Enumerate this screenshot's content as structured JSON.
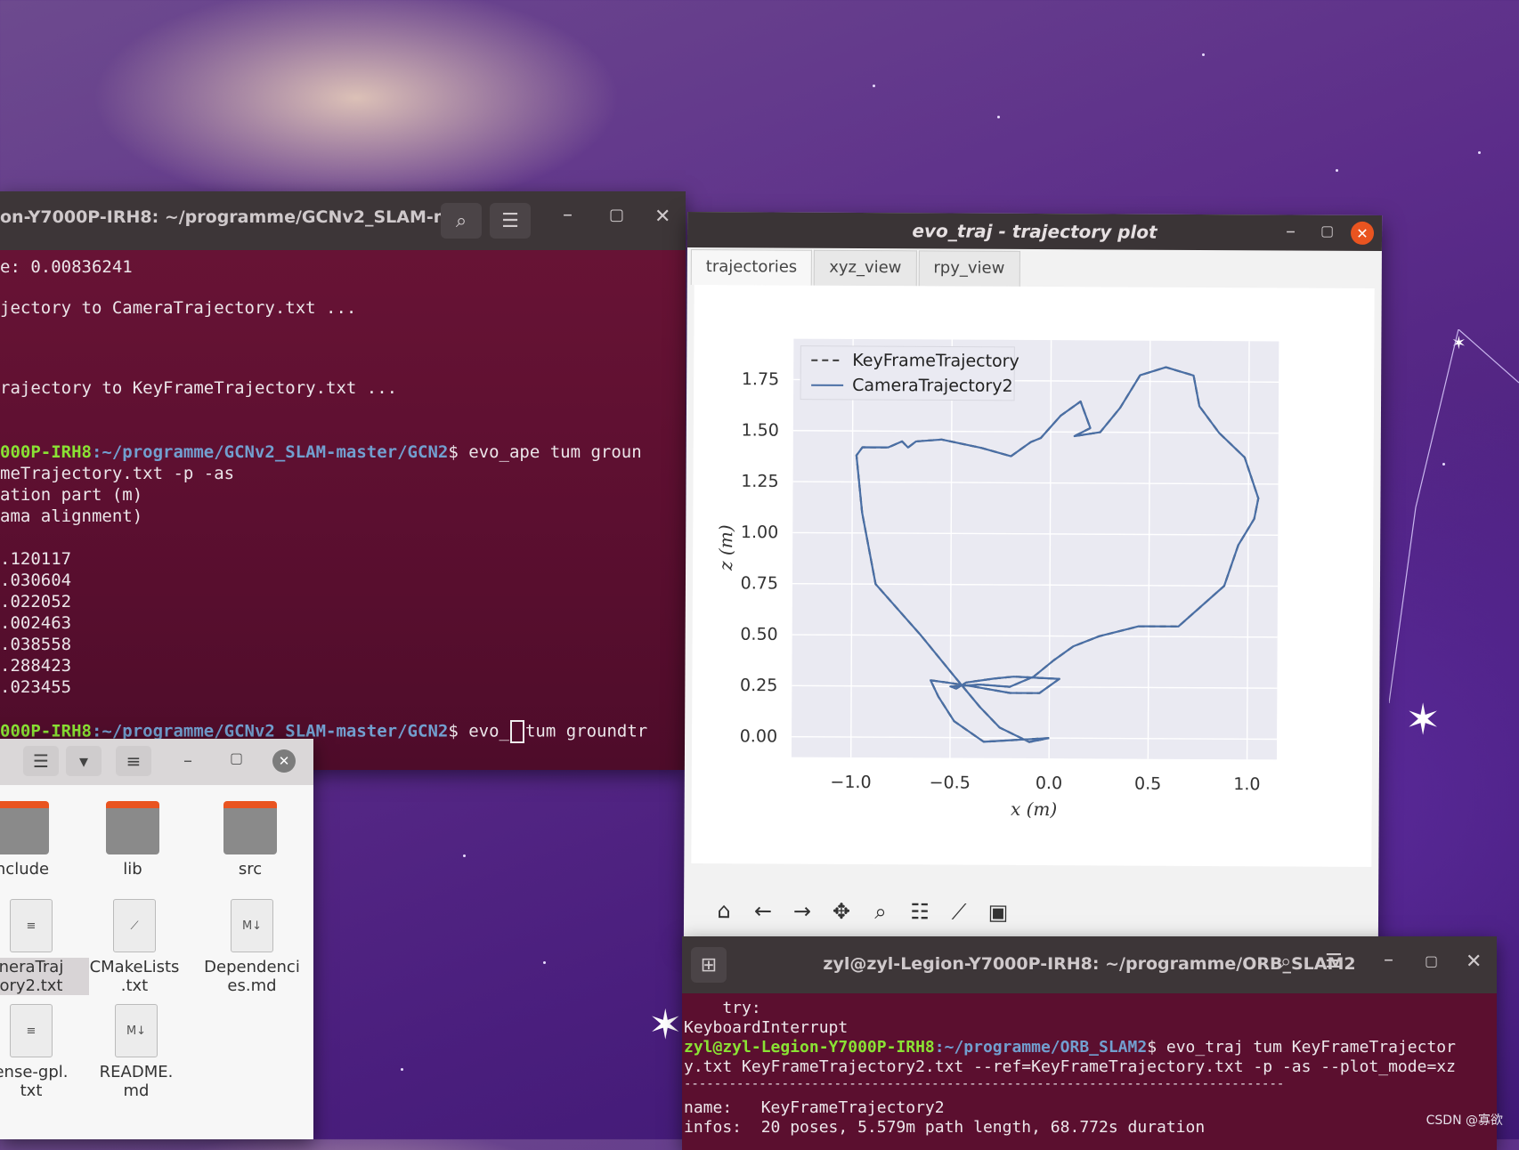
{
  "terminal1": {
    "title": "on-Y7000P-IRH8: ~/programme/GCNv2_SLAM-m...",
    "lines": [
      "e: 0.00836241",
      "",
      "jectory to CameraTrajectory.txt ...",
      "",
      "",
      "rajectory to KeyFrameTrajectory.txt ..."
    ],
    "prompt1_user": "000P-IRH8",
    "prompt1_path": ":~/programme/GCNv2_SLAM-master/GCN2",
    "prompt1_cmd": "$ evo_ape tum groun",
    "out_lines": [
      "meTrajectory.txt -p -as",
      "ation part (m)",
      "ama alignment)",
      "",
      ".120117",
      ".030604",
      ".022052",
      ".002463",
      ".038558",
      ".288423",
      ".023455"
    ],
    "prompt2_user": "000P-IRH8",
    "prompt2_path": ":~/programme/GCNv2_SLAM-master/GCN2",
    "prompt2_cmd_a": "$ evo_",
    "prompt2_cmd_b": "tum groundtr"
  },
  "plot_window": {
    "title": "evo_traj - trajectory plot",
    "tabs": [
      "trajectories",
      "xyz_view",
      "rpy_view"
    ],
    "toolbar_icons": [
      "home-icon",
      "back-icon",
      "forward-icon",
      "pan-icon",
      "zoom-icon",
      "configure-icon",
      "edit-axis-icon",
      "save-icon"
    ]
  },
  "chart_data": {
    "type": "line",
    "xlabel": "x (m)",
    "ylabel": "z (m)",
    "xlim": [
      -1.3,
      1.15
    ],
    "ylim": [
      -0.1,
      1.95
    ],
    "xticks": [
      "−1.0",
      "−0.5",
      "0.0",
      "0.5",
      "1.0"
    ],
    "xtick_values": [
      -1.0,
      -0.5,
      0.0,
      0.5,
      1.0
    ],
    "yticks": [
      "0.00",
      "0.25",
      "0.50",
      "0.75",
      "1.00",
      "1.25",
      "1.50",
      "1.75"
    ],
    "ytick_values": [
      0.0,
      0.25,
      0.5,
      0.75,
      1.0,
      1.25,
      1.5,
      1.75
    ],
    "grid": true,
    "legend_position": "top-left",
    "series": [
      {
        "name": "KeyFrameTrajectory",
        "style": "dashed",
        "color": "#3c3c3c",
        "x": [
          0.0,
          -0.33,
          -0.48,
          -0.56,
          -0.6,
          -0.52,
          -0.38,
          -0.2,
          -0.05,
          0.05,
          -0.18,
          -0.28,
          -0.42,
          -0.47,
          -0.5,
          -0.35,
          -0.2,
          -0.08,
          0.02,
          0.12,
          0.25,
          0.45,
          0.65,
          0.88,
          0.95,
          1.03,
          1.05,
          0.98,
          0.85,
          0.75,
          0.72,
          0.58,
          0.45,
          0.35,
          0.25,
          0.12,
          0.2,
          0.15,
          0.05,
          -0.05,
          -0.1,
          -0.2,
          -0.35,
          -0.55,
          -0.68,
          -0.72,
          -0.75,
          -0.82,
          -0.95,
          -0.98,
          -0.95,
          -0.88,
          -0.65,
          -0.48,
          -0.35,
          -0.25,
          -0.1,
          0.0
        ],
        "y": [
          0.0,
          -0.02,
          0.08,
          0.2,
          0.28,
          0.27,
          0.25,
          0.22,
          0.22,
          0.29,
          0.3,
          0.29,
          0.27,
          0.24,
          0.25,
          0.26,
          0.25,
          0.3,
          0.38,
          0.45,
          0.5,
          0.55,
          0.55,
          0.75,
          0.95,
          1.08,
          1.18,
          1.38,
          1.5,
          1.63,
          1.78,
          1.82,
          1.78,
          1.62,
          1.5,
          1.48,
          1.52,
          1.65,
          1.58,
          1.47,
          1.45,
          1.38,
          1.42,
          1.46,
          1.45,
          1.42,
          1.45,
          1.42,
          1.42,
          1.38,
          1.1,
          0.75,
          0.5,
          0.3,
          0.15,
          0.05,
          -0.02,
          0.0
        ]
      },
      {
        "name": "CameraTrajectory2",
        "style": "solid",
        "color": "#4a6fa5",
        "x": [
          0.0,
          -0.33,
          -0.48,
          -0.56,
          -0.6,
          -0.52,
          -0.38,
          -0.2,
          -0.05,
          0.05,
          -0.18,
          -0.28,
          -0.42,
          -0.47,
          -0.5,
          -0.35,
          -0.2,
          -0.08,
          0.02,
          0.12,
          0.25,
          0.45,
          0.65,
          0.88,
          0.95,
          1.03,
          1.05,
          0.98,
          0.85,
          0.75,
          0.72,
          0.58,
          0.45,
          0.35,
          0.25,
          0.12,
          0.2,
          0.15,
          0.05,
          -0.05,
          -0.1,
          -0.2,
          -0.35,
          -0.55,
          -0.68,
          -0.72,
          -0.75,
          -0.82,
          -0.95,
          -0.98,
          -0.95,
          -0.88,
          -0.65,
          -0.48,
          -0.35,
          -0.25,
          -0.1,
          0.0
        ],
        "y": [
          0.0,
          -0.02,
          0.08,
          0.2,
          0.28,
          0.27,
          0.25,
          0.22,
          0.22,
          0.29,
          0.3,
          0.29,
          0.27,
          0.24,
          0.25,
          0.26,
          0.25,
          0.3,
          0.38,
          0.45,
          0.5,
          0.55,
          0.55,
          0.75,
          0.95,
          1.08,
          1.18,
          1.38,
          1.5,
          1.63,
          1.78,
          1.82,
          1.78,
          1.62,
          1.5,
          1.48,
          1.52,
          1.65,
          1.58,
          1.47,
          1.45,
          1.38,
          1.42,
          1.46,
          1.45,
          1.42,
          1.45,
          1.42,
          1.42,
          1.38,
          1.1,
          0.75,
          0.5,
          0.3,
          0.15,
          0.05,
          -0.02,
          0.0
        ]
      }
    ]
  },
  "file_manager": {
    "items": [
      {
        "label": "nclude",
        "kind": "folder"
      },
      {
        "label": "lib",
        "kind": "folder"
      },
      {
        "label": "src",
        "kind": "folder"
      },
      {
        "label": "neraTraj\nory2.txt",
        "kind": "text",
        "selected": true
      },
      {
        "label": "CMakeLists\n.txt",
        "kind": "cmake"
      },
      {
        "label": "Dependenci\nes.md",
        "kind": "md"
      },
      {
        "label": "ense-gpl.\ntxt",
        "kind": "text"
      },
      {
        "label": "README.\nmd",
        "kind": "md"
      }
    ]
  },
  "terminal2": {
    "title": "zyl@zyl-Legion-Y7000P-IRH8: ~/programme/ORB_SLAM2",
    "line1": "    try:",
    "line2": "KeyboardInterrupt",
    "prompt_user": "zyl@zyl-Legion-Y7000P-IRH8",
    "prompt_path": ":~/programme/ORB_SLAM2",
    "prompt_cmd": "$ evo_traj tum KeyFrameTrajector",
    "line4": "y.txt KeyFrameTrajectory2.txt --ref=KeyFrameTrajectory.txt -p -as --plot_mode=xz",
    "line5": "--------------------------------------------------------------------------------",
    "line6": "name:   KeyFrameTrajectory2",
    "line7": "infos:  20 poses, 5.579m path length, 68.772s duration"
  },
  "watermark": "CSDN @寡欲"
}
